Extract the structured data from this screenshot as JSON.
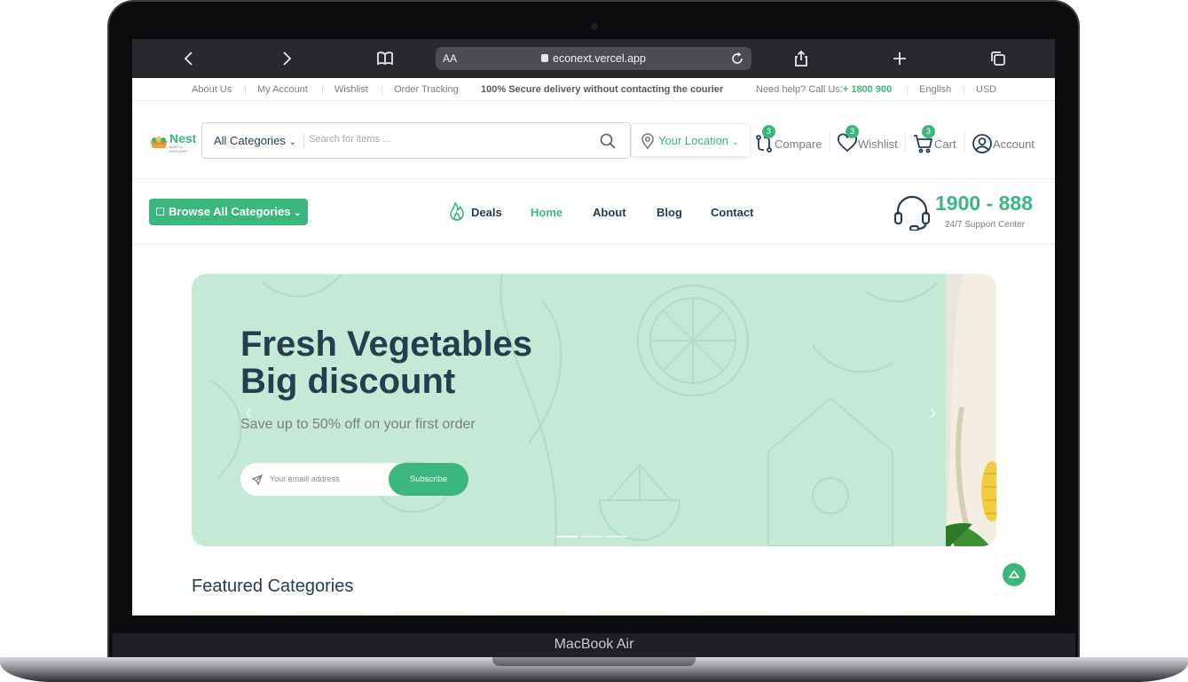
{
  "device": {
    "label": "MacBook Air"
  },
  "browser": {
    "text_size_label": "AA",
    "url": "econext.vercel.app"
  },
  "topbar": {
    "links": [
      "About Us",
      "My Account",
      "Wishlist",
      "Order Tracking"
    ],
    "notice": "100% Secure delivery without contacting the courier",
    "help_prefix": "Need help? Call Us:",
    "help_phone": "+ 1800 900",
    "language": "English",
    "currency": "USD"
  },
  "header": {
    "logo_name": "Nest",
    "logo_tagline": "MART & GROCERY",
    "category_select": "All Categories",
    "search_placeholder": "Search for items ...",
    "location": "Your Location",
    "actions": [
      {
        "label": "Compare",
        "count": "3"
      },
      {
        "label": "Wishlist",
        "count": "3"
      },
      {
        "label": "Cart",
        "count": "3"
      },
      {
        "label": "Account"
      }
    ]
  },
  "nav": {
    "browse_label": "Browse All Categories",
    "items": [
      "Deals",
      "Home",
      "About",
      "Blog",
      "Contact"
    ],
    "active": "Home",
    "phone": "1900 - 888",
    "support_label": "24/7 Support Center"
  },
  "hero": {
    "title_line1": "Fresh Vegetables",
    "title_line2": "Big discount",
    "subtitle": "Save up to 50% off on your first order",
    "email_placeholder": "Your emaill address",
    "subscribe_label": "Subscribe",
    "slide_count": 3,
    "active_slide": 1
  },
  "featured": {
    "title": "Featured Categories"
  },
  "colors": {
    "brand": "#3bb77e",
    "heading": "#253d4e",
    "hero_bg": "#c4e9d7"
  }
}
